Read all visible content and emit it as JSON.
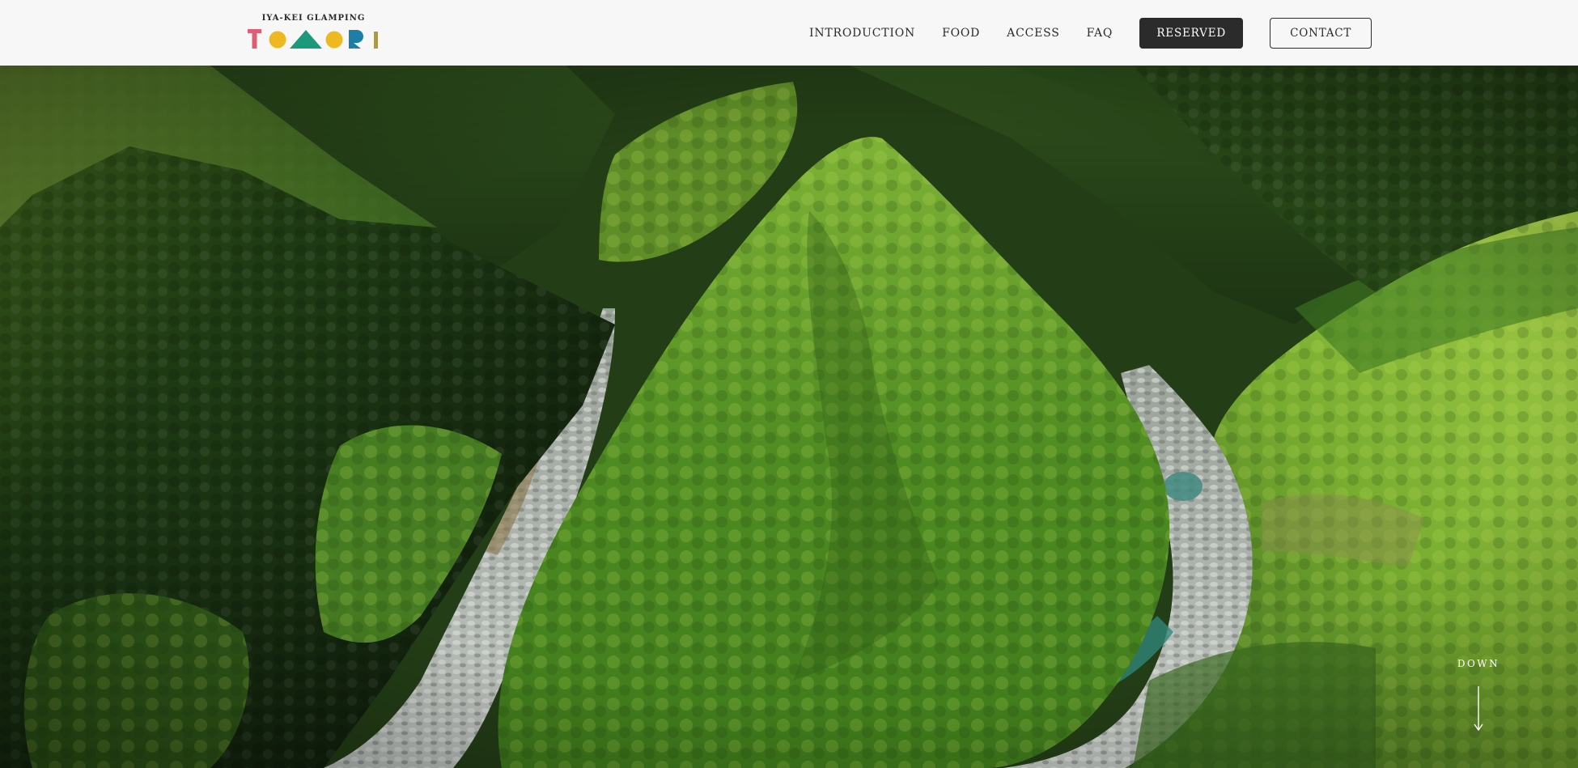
{
  "header": {
    "logo": {
      "subtitle": "IYA-KEI GLAMPING",
      "wordmark": "TOMORI",
      "letter_colors": {
        "T": "#dd5e74",
        "O1": "#eeb920",
        "M": "#1a9a7a",
        "O2": "#eeb920",
        "R": "#1d7fa8",
        "I": "#a89a4a"
      }
    },
    "nav": {
      "items": [
        {
          "label": "INTRODUCTION"
        },
        {
          "label": "FOOD"
        },
        {
          "label": "ACCESS"
        },
        {
          "label": "FAQ"
        }
      ],
      "reserved_label": "RESERVED",
      "contact_label": "CONTACT"
    }
  },
  "hero": {
    "scroll_label": "DOWN",
    "scroll_icon": "arrow-down-icon"
  },
  "colors": {
    "header_bg": "#f7f7f7",
    "text_dark": "#2b2b2b",
    "button_dark": "#2b2b2b"
  }
}
